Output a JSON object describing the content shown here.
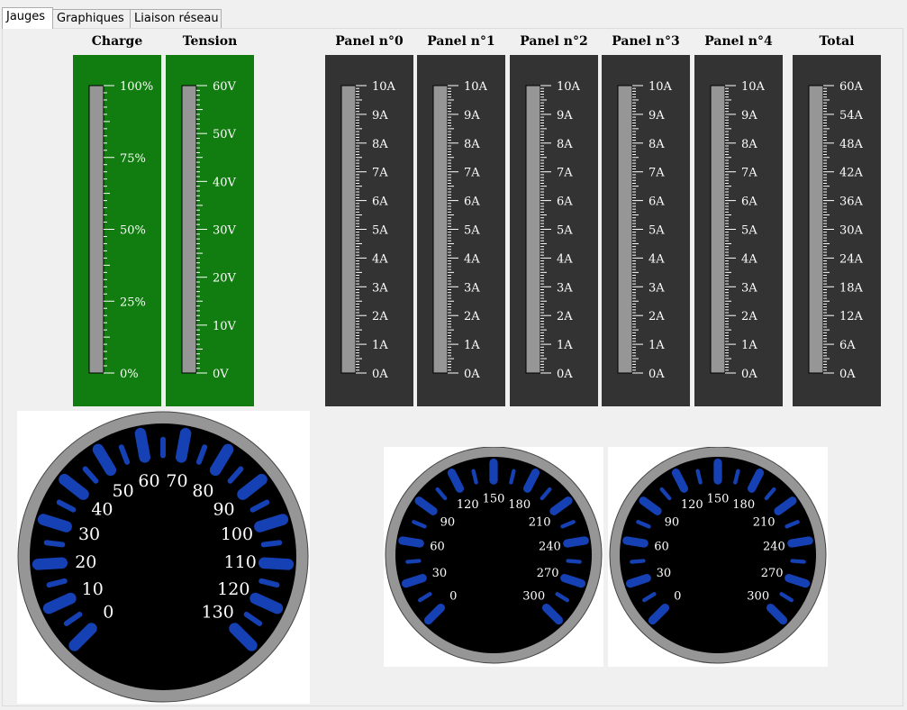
{
  "tabs": [
    {
      "label": "Jauges",
      "active": true
    },
    {
      "label": "Graphiques",
      "active": false
    },
    {
      "label": "Liaison réseau",
      "active": false
    }
  ],
  "bar_gauges": [
    {
      "title": "Charge",
      "background": "#117c0f",
      "labels": [
        "100%",
        "75%",
        "50%",
        "25%",
        "0%"
      ],
      "value": 0
    },
    {
      "title": "Tension",
      "background": "#117c0f",
      "labels": [
        "60V",
        "50V",
        "40V",
        "30V",
        "20V",
        "10V",
        "0V"
      ],
      "value": 0
    },
    {
      "title": "Panel n°0",
      "background": "#333333",
      "labels": [
        "10A",
        "9A",
        "8A",
        "7A",
        "6A",
        "5A",
        "4A",
        "3A",
        "2A",
        "1A",
        "0A"
      ],
      "value": 0
    },
    {
      "title": "Panel n°1",
      "background": "#333333",
      "labels": [
        "10A",
        "9A",
        "8A",
        "7A",
        "6A",
        "5A",
        "4A",
        "3A",
        "2A",
        "1A",
        "0A"
      ],
      "value": 0
    },
    {
      "title": "Panel n°2",
      "background": "#333333",
      "labels": [
        "10A",
        "9A",
        "8A",
        "7A",
        "6A",
        "5A",
        "4A",
        "3A",
        "2A",
        "1A",
        "0A"
      ],
      "value": 0
    },
    {
      "title": "Panel n°3",
      "background": "#333333",
      "labels": [
        "10A",
        "9A",
        "8A",
        "7A",
        "6A",
        "5A",
        "4A",
        "3A",
        "2A",
        "1A",
        "0A"
      ],
      "value": 0
    },
    {
      "title": "Panel n°4",
      "background": "#333333",
      "labels": [
        "10A",
        "9A",
        "8A",
        "7A",
        "6A",
        "5A",
        "4A",
        "3A",
        "2A",
        "1A",
        "0A"
      ],
      "value": 0
    },
    {
      "title": "Total",
      "background": "#333333",
      "labels": [
        "60A",
        "54A",
        "48A",
        "42A",
        "36A",
        "30A",
        "24A",
        "18A",
        "12A",
        "6A",
        "0A"
      ],
      "value": 0
    }
  ],
  "dials": [
    {
      "labels": [
        "0",
        "10",
        "20",
        "30",
        "40",
        "50",
        "60",
        "70",
        "80",
        "90",
        "100",
        "110",
        "120",
        "130"
      ]
    },
    {
      "labels": [
        "0",
        "30",
        "60",
        "90",
        "120",
        "150",
        "180",
        "210",
        "240",
        "270",
        "300"
      ]
    },
    {
      "labels": [
        "0",
        "30",
        "60",
        "90",
        "120",
        "150",
        "180",
        "210",
        "240",
        "270",
        "300"
      ]
    }
  ],
  "colors": {
    "tick_blue": "#1541b5",
    "dial_ring": "#969696",
    "dial_face": "#000000",
    "bar_track": "#969696"
  }
}
